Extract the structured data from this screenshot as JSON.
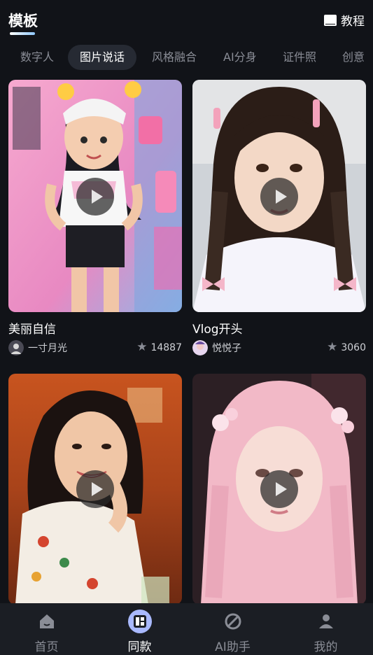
{
  "header": {
    "title": "模板",
    "tutorial_label": "教程"
  },
  "tabs": [
    {
      "label": "数字人",
      "active": false
    },
    {
      "label": "图片说话",
      "active": true
    },
    {
      "label": "风格融合",
      "active": false
    },
    {
      "label": "AI分身",
      "active": false
    },
    {
      "label": "证件照",
      "active": false
    },
    {
      "label": "创意",
      "active": false
    }
  ],
  "cards": [
    {
      "title": "美丽自信",
      "author": "一寸月光",
      "likes": "14887"
    },
    {
      "title": "Vlog开头",
      "author": "悦悦子",
      "likes": "3060"
    },
    {
      "title": "",
      "author": "",
      "likes": ""
    },
    {
      "title": "",
      "author": "",
      "likes": ""
    }
  ],
  "bottom_nav": [
    {
      "label": "首页",
      "icon": "home-icon",
      "active": false
    },
    {
      "label": "同款",
      "icon": "template-icon",
      "active": true
    },
    {
      "label": "AI助手",
      "icon": "assistant-icon",
      "active": false
    },
    {
      "label": "我的",
      "icon": "profile-icon",
      "active": false
    }
  ],
  "colors": {
    "background": "#111318",
    "nav_background": "#1b1e24",
    "active_tab_bg": "#262a33",
    "inactive_text": "#8a8d96",
    "accent": "#8fc8ff"
  }
}
